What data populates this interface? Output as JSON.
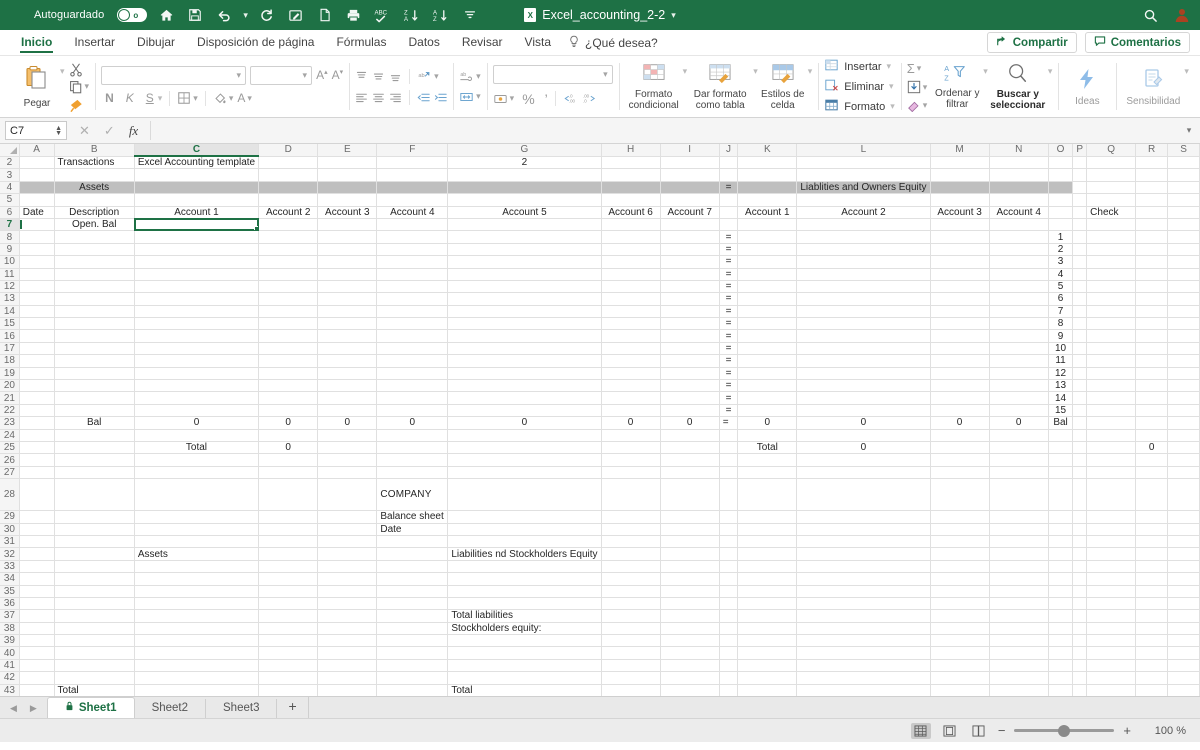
{
  "titlebar": {
    "autosave_label": "Autoguardado",
    "autosave_state": "o",
    "filename": "Excel_accounting_2-2",
    "icons": [
      "home-icon",
      "save-icon",
      "undo-icon",
      "redo-icon",
      "edit-icon",
      "new-file-icon",
      "print-icon",
      "spellcheck-icon",
      "sort-az-icon",
      "sort-za-icon",
      "overflow-icon"
    ],
    "search_icon": "search-icon",
    "account_icon": "account-icon"
  },
  "ribbon_tabs": {
    "tabs": [
      "Inicio",
      "Insertar",
      "Dibujar",
      "Disposición de página",
      "Fórmulas",
      "Datos",
      "Revisar",
      "Vista"
    ],
    "active": "Inicio",
    "tellme": "¿Qué desea?",
    "share_label": "Compartir",
    "comments_label": "Comentarios"
  },
  "ribbon": {
    "clipboard": {
      "paste_label": "Pegar"
    },
    "font": {
      "name_value": "",
      "size_value": "",
      "bold": "N",
      "italic": "K",
      "underline": "S"
    },
    "styles": {
      "conditional_format": "Formato condicional",
      "format_as_table": "Dar formato como tabla",
      "cell_styles": "Estilos de celda"
    },
    "cells": {
      "insert": "Insertar",
      "delete": "Eliminar",
      "format": "Formato"
    },
    "editing": {
      "sort_filter": "Ordenar y filtrar",
      "find_select": "Buscar y seleccionar"
    },
    "ideas_label": "Ideas",
    "sensitivity_label": "Sensibilidad"
  },
  "formula_bar": {
    "namebox": "C7",
    "cancel_icon": "close-icon",
    "confirm_icon": "check-icon",
    "fx_icon": "fx-icon",
    "value": ""
  },
  "sheet": {
    "columns": [
      "A",
      "B",
      "C",
      "D",
      "E",
      "F",
      "G",
      "H",
      "I",
      "J",
      "K",
      "L",
      "M",
      "N",
      "O",
      "P",
      "Q",
      "R",
      "S"
    ],
    "selected_column": "C",
    "selected_cell": "C7",
    "rows": [
      2,
      3,
      4,
      5,
      6,
      7,
      8,
      9,
      10,
      11,
      12,
      13,
      14,
      15,
      16,
      17,
      18,
      19,
      20,
      21,
      22,
      23,
      24,
      25,
      26,
      27,
      28,
      29,
      30,
      31,
      32,
      33,
      34,
      35,
      36,
      37,
      38,
      39,
      40,
      41,
      42,
      43
    ],
    "cells": {
      "B2": "Transactions",
      "C2": "Excel Accounting template",
      "G2": "2",
      "B4": "Assets",
      "J4": "=",
      "L4": "Liablities and Owners Equity",
      "A6": "Date",
      "B6": "Description",
      "C6": "Account 1",
      "D6": "Account 2",
      "E6": "Account 3",
      "F6": "Account 4",
      "G6": "Account 5",
      "H6": "Account 6",
      "I6": "Account 7",
      "K6": "Account 1",
      "L6": "Account 2",
      "M6": "Account 3",
      "N6": "Account 4",
      "Q6": "Check",
      "B7": "Open. Bal",
      "J8": "=",
      "O8": "1",
      "J9": "=",
      "O9": "2",
      "J10": "=",
      "O10": "3",
      "J11": "=",
      "O11": "4",
      "J12": "=",
      "O12": "5",
      "J13": "=",
      "O13": "6",
      "J14": "=",
      "O14": "7",
      "J15": "=",
      "O15": "8",
      "J16": "=",
      "O16": "9",
      "J17": "=",
      "O17": "10",
      "J18": "=",
      "O18": "11",
      "J19": "=",
      "O19": "12",
      "J20": "=",
      "O20": "13",
      "J21": "=",
      "O21": "14",
      "J22": "=",
      "O22": "15",
      "B23": "Bal",
      "C23": "0",
      "D23": "0",
      "E23": "0",
      "F23": "0",
      "G23": "0",
      "H23": "0",
      "I23": "0",
      "J23": "=",
      "K23": "0",
      "L23": "0",
      "M23": "0",
      "N23": "0",
      "O23": "Bal",
      "C25": "Total",
      "D25": "0",
      "K25": "Total",
      "L25": "0",
      "R25": "0",
      "F28": "COMPANY",
      "F29": "Balance sheet",
      "F30": "Date",
      "C32": "Assets",
      "G32": "Liabilities nd Stockholders Equity",
      "G37": "Total liabilities",
      "G38": "Stockholders equity:",
      "B43": "Total",
      "G43": "Total"
    }
  },
  "sheet_tabs": {
    "tabs": [
      {
        "name": "Sheet1",
        "locked": true,
        "active": true
      },
      {
        "name": "Sheet2",
        "locked": false,
        "active": false
      },
      {
        "name": "Sheet3",
        "locked": false,
        "active": false
      }
    ],
    "add_label": "+",
    "prev_icon": "chevron-left-icon",
    "next_icon": "chevron-right-icon"
  },
  "status_bar": {
    "views": [
      "normal-view-icon",
      "page-layout-icon",
      "page-break-icon"
    ],
    "active_view": "normal-view-icon",
    "zoom_out": "−",
    "zoom_in": "+",
    "zoom_level": "100 %"
  },
  "colors": {
    "brand_green": "#1e7145",
    "band_gray": "#bfbfbf",
    "grid_line": "#e0e0e0"
  }
}
